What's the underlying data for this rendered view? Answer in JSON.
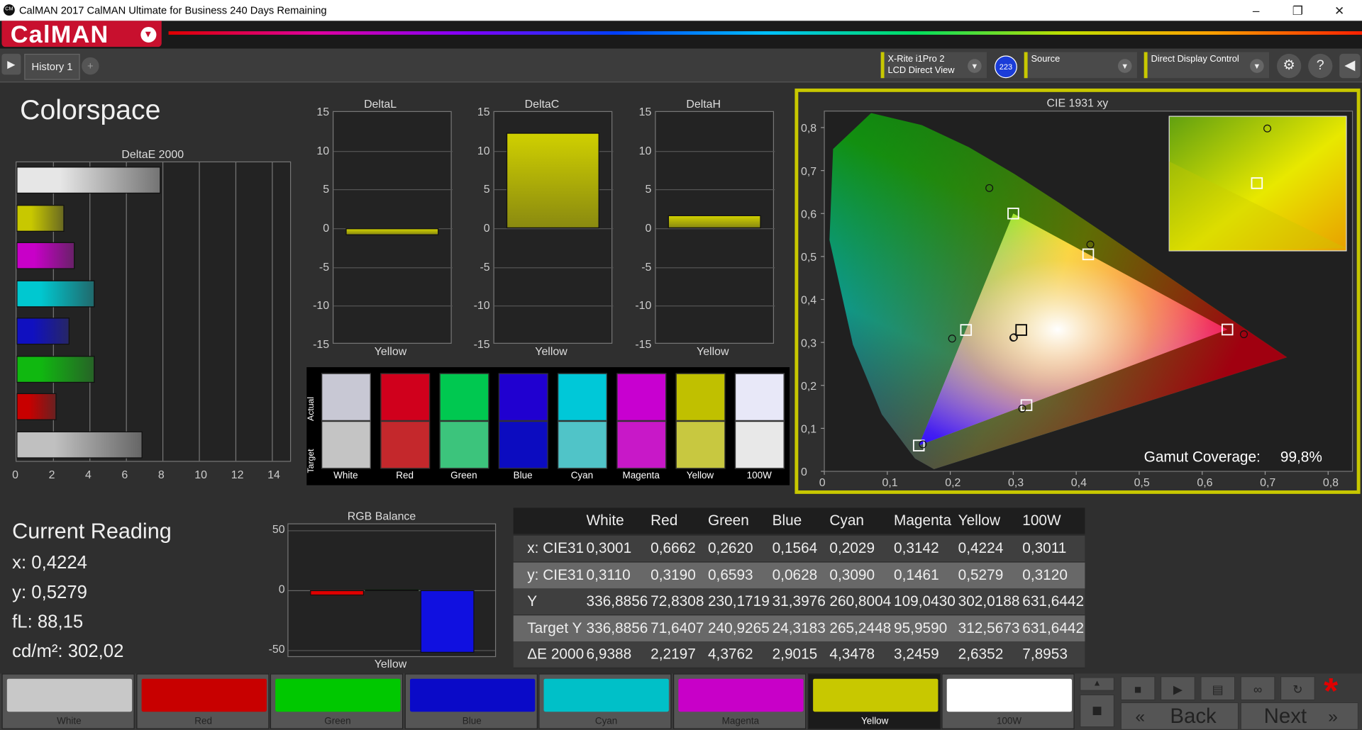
{
  "window": {
    "title": "CalMAN 2017 CalMAN Ultimate for Business 240 Days Remaining",
    "app_icon": "CM"
  },
  "header": {
    "logo": "CalMAN"
  },
  "tabs": [
    {
      "label": "History 1"
    }
  ],
  "devices": {
    "meter_line1": "X-Rite i1Pro 2",
    "meter_line2": "LCD Direct View",
    "meter_badge": "223",
    "source": "Source",
    "display": "Direct Display Control"
  },
  "icons": {
    "play": "play-icon",
    "settings": "gear-icon",
    "help": "help-icon",
    "collapse": "chevron-left-icon",
    "close_x": "close-icon"
  },
  "colorspace": {
    "title": "Colorspace"
  },
  "deltae_chart": {
    "title": "DeltaE 2000",
    "x_ticks": [
      "0",
      "2",
      "4",
      "6",
      "8",
      "10",
      "12",
      "14"
    ]
  },
  "chart_data": [
    {
      "type": "bar",
      "title": "DeltaE 2000",
      "orientation": "horizontal",
      "categories": [
        "White",
        "Yellow",
        "Magenta",
        "Cyan",
        "Blue",
        "Green",
        "Red",
        "100W"
      ],
      "values": [
        7.9,
        2.6,
        3.2,
        4.3,
        2.9,
        4.3,
        2.2,
        6.9
      ],
      "colors": [
        "#e6e6e6",
        "#c8c800",
        "#c800c8",
        "#00c8d0",
        "#1010c0",
        "#10b810",
        "#c80000",
        "#c0c0c0"
      ],
      "xlim": [
        0,
        15
      ]
    },
    {
      "type": "bar",
      "title": "DeltaL",
      "categories": [
        "Yellow"
      ],
      "values": [
        -0.9
      ],
      "ylim": [
        -15,
        15
      ],
      "y_ticks": [
        "15",
        "10",
        "5",
        "0",
        "-5",
        "-10",
        "-15"
      ]
    },
    {
      "type": "bar",
      "title": "DeltaC",
      "categories": [
        "Yellow"
      ],
      "values": [
        12.3
      ],
      "ylim": [
        -15,
        15
      ],
      "y_ticks": [
        "15",
        "10",
        "5",
        "0",
        "-5",
        "-10",
        "-15"
      ]
    },
    {
      "type": "bar",
      "title": "DeltaH",
      "categories": [
        "Yellow"
      ],
      "values": [
        1.7
      ],
      "ylim": [
        -15,
        15
      ],
      "y_ticks": [
        "15",
        "10",
        "5",
        "0",
        "-5",
        "-10",
        "-15"
      ]
    },
    {
      "type": "scatter",
      "title": "CIE 1931 xy",
      "xlim": [
        0,
        0.8
      ],
      "ylim": [
        0,
        0.85
      ],
      "x_ticks": [
        "0",
        "0,1",
        "0,2",
        "0,3",
        "0,4",
        "0,5",
        "0,6",
        "0,7",
        "0,8"
      ],
      "y_ticks": [
        "0",
        "0,1",
        "0,2",
        "0,3",
        "0,4",
        "0,5",
        "0,6",
        "0,7",
        "0,8"
      ],
      "gamut_coverage_label": "Gamut Coverage:",
      "gamut_coverage_value": "99,8%",
      "targets": [
        {
          "name": "Red",
          "x": 0.64,
          "y": 0.33
        },
        {
          "name": "Green",
          "x": 0.3,
          "y": 0.6
        },
        {
          "name": "Blue",
          "x": 0.15,
          "y": 0.06
        },
        {
          "name": "Cyan",
          "x": 0.225,
          "y": 0.329
        },
        {
          "name": "Magenta",
          "x": 0.321,
          "y": 0.154
        },
        {
          "name": "Yellow",
          "x": 0.419,
          "y": 0.505
        },
        {
          "name": "White",
          "x": 0.3127,
          "y": 0.329
        }
      ],
      "measured": [
        {
          "name": "White",
          "x": 0.3001,
          "y": 0.311
        },
        {
          "name": "Red",
          "x": 0.6662,
          "y": 0.319
        },
        {
          "name": "Green",
          "x": 0.262,
          "y": 0.6593
        },
        {
          "name": "Blue",
          "x": 0.1564,
          "y": 0.0628
        },
        {
          "name": "Cyan",
          "x": 0.2029,
          "y": 0.309
        },
        {
          "name": "Magenta",
          "x": 0.3142,
          "y": 0.1461
        },
        {
          "name": "Yellow",
          "x": 0.4224,
          "y": 0.5279
        },
        {
          "name": "100W",
          "x": 0.3011,
          "y": 0.312
        }
      ]
    },
    {
      "type": "bar",
      "title": "RGB Balance",
      "categories": [
        "Red",
        "Green",
        "Blue"
      ],
      "values": [
        -4,
        0,
        -52
      ],
      "colors": [
        "#e00000",
        "#00c000",
        "#1010e0"
      ],
      "ylim": [
        -55,
        55
      ],
      "y_ticks": [
        "50",
        "0",
        "-50"
      ],
      "xlabel": "Yellow"
    }
  ],
  "delta_panels": [
    {
      "title": "DeltaL",
      "xlabel": "Yellow"
    },
    {
      "title": "DeltaC",
      "xlabel": "Yellow"
    },
    {
      "title": "DeltaH",
      "xlabel": "Yellow"
    }
  ],
  "delta_y_ticks": [
    "15",
    "10",
    "5",
    "0",
    "-5",
    "-10",
    "-15"
  ],
  "swatches": {
    "actual_label": "Actual",
    "target_label": "Target",
    "items": [
      {
        "name": "White",
        "actual": "#c8c8d4",
        "target": "#c4c4c4"
      },
      {
        "name": "Red",
        "actual": "#d0001c",
        "target": "#c4282c"
      },
      {
        "name": "Green",
        "actual": "#00c850",
        "target": "#3cc47c"
      },
      {
        "name": "Blue",
        "actual": "#2000d0",
        "target": "#0c0cc0"
      },
      {
        "name": "Cyan",
        "actual": "#00c8d8",
        "target": "#50c4c8"
      },
      {
        "name": "Magenta",
        "actual": "#c800d0",
        "target": "#c818c8"
      },
      {
        "name": "Yellow",
        "actual": "#c0c000",
        "target": "#c8c840"
      },
      {
        "name": "100W",
        "actual": "#e8e8f8",
        "target": "#e8e8e8"
      }
    ]
  },
  "cie_chart": {
    "title": "CIE 1931 xy"
  },
  "current_reading": {
    "title": "Current Reading",
    "x": "x: 0,4224",
    "y": "y: 0,5279",
    "fl": "fL: 88,15",
    "cdm2": "cd/m²: 302,02"
  },
  "rgb_balance": {
    "title": "RGB Balance",
    "xlabel": "Yellow",
    "y_ticks": [
      "50",
      "0",
      "-50"
    ]
  },
  "table": {
    "headers": [
      "",
      "White",
      "Red",
      "Green",
      "Blue",
      "Cyan",
      "Magenta",
      "Yellow",
      "100W"
    ],
    "rows": [
      [
        "x: CIE31",
        "0,3001",
        "0,6662",
        "0,2620",
        "0,1564",
        "0,2029",
        "0,3142",
        "0,4224",
        "0,3011"
      ],
      [
        "y: CIE31",
        "0,3110",
        "0,3190",
        "0,6593",
        "0,0628",
        "0,3090",
        "0,1461",
        "0,5279",
        "0,3120"
      ],
      [
        "Y",
        "336,8856",
        "72,8308",
        "230,1719",
        "31,3976",
        "260,8004",
        "109,0430",
        "302,0188",
        "631,6442"
      ],
      [
        "Target Y",
        "336,8856",
        "71,6407",
        "240,9265",
        "24,3183",
        "265,2448",
        "95,9590",
        "312,5673",
        "631,6442"
      ],
      [
        "ΔE 2000",
        "6,9388",
        "2,2197",
        "4,3762",
        "2,9015",
        "4,3478",
        "3,2459",
        "2,6352",
        "7,8953"
      ]
    ]
  },
  "bottom_patches": [
    {
      "name": "White",
      "color": "#c8c8c8"
    },
    {
      "name": "Red",
      "color": "#c80000"
    },
    {
      "name": "Green",
      "color": "#00c800"
    },
    {
      "name": "Blue",
      "color": "#0a0ac8"
    },
    {
      "name": "Cyan",
      "color": "#00c0c8"
    },
    {
      "name": "Magenta",
      "color": "#c800c8"
    },
    {
      "name": "Yellow",
      "color": "#c8c800",
      "selected": true
    },
    {
      "name": "100W",
      "color": "#ffffff"
    }
  ],
  "controls": {
    "back": "Back",
    "next": "Next"
  },
  "colors": {
    "brand": "#c8102e",
    "highlight": "#c8c800"
  }
}
